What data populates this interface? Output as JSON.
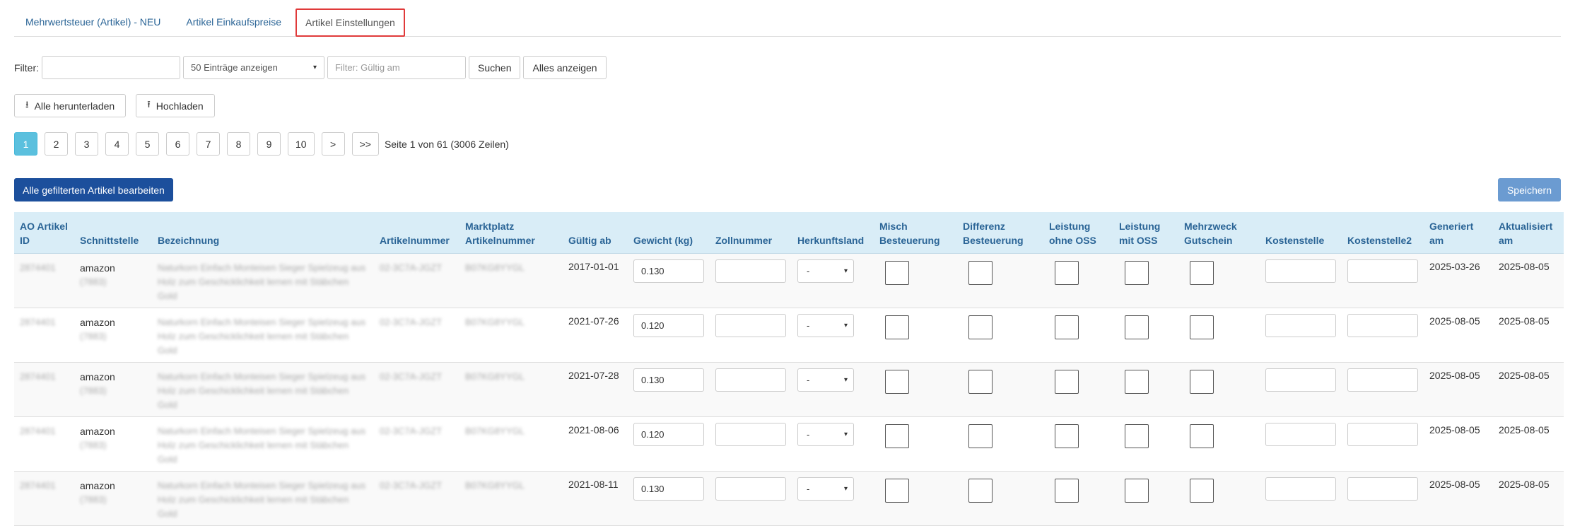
{
  "tabs": [
    {
      "label": "Mehrwertsteuer (Artikel) - NEU"
    },
    {
      "label": "Artikel Einkaufspreise"
    },
    {
      "label": "Artikel Einstellungen"
    }
  ],
  "filter": {
    "label": "Filter:",
    "text_value": "",
    "entries_select": "50 Einträge anzeigen",
    "valid_placeholder": "Filter: Gültig am",
    "search_label": "Suchen",
    "show_all_label": "Alles anzeigen"
  },
  "actions": {
    "download_all": "Alle herunterladen",
    "upload": "Hochladen",
    "edit_all_filtered": "Alle gefilterten Artikel bearbeiten",
    "save": "Speichern"
  },
  "pagination": {
    "pages": [
      "1",
      "2",
      "3",
      "4",
      "5",
      "6",
      "7",
      "8",
      "9",
      "10",
      ">",
      ">>"
    ],
    "current": "1",
    "info": "Seite 1 von 61 (3006 Zeilen)"
  },
  "table": {
    "headers": {
      "ao_id": "AO Artikel ID",
      "interface": "Schnittstelle",
      "name": "Bezeichnung",
      "article_no": "Artikelnummer",
      "marketplace_no": "Marktplatz Artikelnummer",
      "valid_from": "Gültig ab",
      "weight": "Gewicht (kg)",
      "customs_no": "Zollnummer",
      "origin": "Herkunftsland",
      "mixed_tax": "Misch Besteuerung",
      "diff_tax": "Differenz Besteuerung",
      "service_no_oss": "Leistung ohne OSS",
      "service_oss": "Leistung mit OSS",
      "voucher": "Mehrzweck Gutschein",
      "cost_center": "Kostenstelle",
      "cost_center2": "Kostenstelle2",
      "generated": "Generiert am",
      "updated": "Aktualisiert am"
    },
    "rows": [
      {
        "ao_id": "2874401",
        "interface": "amazon",
        "interface_sub": "(7883)",
        "name": "Naturkorn Einfach Monteisen Sieger Spielzeug aus Holz zum Geschicklichkeit lernen mit Stäbchen Gold",
        "article_no": "02-3C7A-JGZT",
        "marketplace_no": "B07KG8YYGL",
        "valid_from": "2017-01-01",
        "weight": "0.130",
        "customs_no": "",
        "origin": "-",
        "cost_center": "",
        "cost_center2": "",
        "generated": "2025-03-26",
        "updated": "2025-08-05"
      },
      {
        "ao_id": "2874401",
        "interface": "amazon",
        "interface_sub": "(7883)",
        "name": "Naturkorn Einfach Monteisen Sieger Spielzeug aus Holz zum Geschicklichkeit lernen mit Stäbchen Gold",
        "article_no": "02-3C7A-JGZT",
        "marketplace_no": "B07KG8YYGL",
        "valid_from": "2021-07-26",
        "weight": "0.120",
        "customs_no": "",
        "origin": "-",
        "cost_center": "",
        "cost_center2": "",
        "generated": "2025-08-05",
        "updated": "2025-08-05"
      },
      {
        "ao_id": "2874401",
        "interface": "amazon",
        "interface_sub": "(7883)",
        "name": "Naturkorn Einfach Monteisen Sieger Spielzeug aus Holz zum Geschicklichkeit lernen mit Stäbchen Gold",
        "article_no": "02-3C7A-JGZT",
        "marketplace_no": "B07KG8YYGL",
        "valid_from": "2021-07-28",
        "weight": "0.130",
        "customs_no": "",
        "origin": "-",
        "cost_center": "",
        "cost_center2": "",
        "generated": "2025-08-05",
        "updated": "2025-08-05"
      },
      {
        "ao_id": "2874401",
        "interface": "amazon",
        "interface_sub": "(7883)",
        "name": "Naturkorn Einfach Monteisen Sieger Spielzeug aus Holz zum Geschicklichkeit lernen mit Stäbchen Gold",
        "article_no": "02-3C7A-JGZT",
        "marketplace_no": "B07KG8YYGL",
        "valid_from": "2021-08-06",
        "weight": "0.120",
        "customs_no": "",
        "origin": "-",
        "cost_center": "",
        "cost_center2": "",
        "generated": "2025-08-05",
        "updated": "2025-08-05"
      },
      {
        "ao_id": "2874401",
        "interface": "amazon",
        "interface_sub": "(7883)",
        "name": "Naturkorn Einfach Monteisen Sieger Spielzeug aus Holz zum Geschicklichkeit lernen mit Stäbchen Gold",
        "article_no": "02-3C7A-JGZT",
        "marketplace_no": "B07KG8YYGL",
        "valid_from": "2021-08-11",
        "weight": "0.130",
        "customs_no": "",
        "origin": "-",
        "cost_center": "",
        "cost_center2": "",
        "generated": "2025-08-05",
        "updated": "2025-08-05"
      }
    ]
  },
  "icons": {
    "download": "download-icon",
    "upload": "upload-icon",
    "select": "chevron-down-icon"
  },
  "colors": {
    "link": "#2a6496",
    "active_tab_border": "#e03a3a",
    "primary": "#1c4f9c",
    "save": "#6b9bd1",
    "page_active": "#5bc0de",
    "header_bg": "#d9edf7"
  }
}
